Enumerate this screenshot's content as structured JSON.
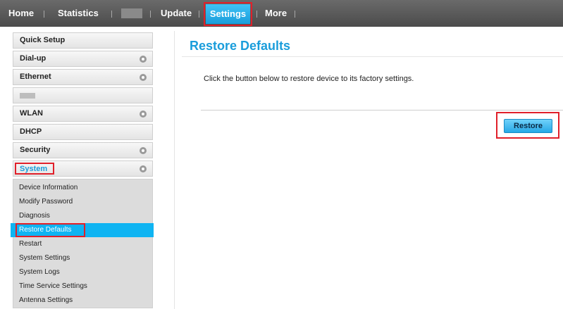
{
  "topnav": {
    "home": "Home",
    "statistics": "Statistics",
    "update": "Update",
    "settings": "Settings",
    "more": "More"
  },
  "sidebar": {
    "items": [
      {
        "label": "Quick Setup"
      },
      {
        "label": "Dial-up"
      },
      {
        "label": "Ethernet"
      },
      {
        "label": ""
      },
      {
        "label": "WLAN"
      },
      {
        "label": "DHCP"
      },
      {
        "label": "Security"
      },
      {
        "label": "System"
      }
    ],
    "system_submenu": [
      "Device Information",
      "Modify Password",
      "Diagnosis",
      "Restore Defaults",
      "Restart",
      "System Settings",
      "System Logs",
      "Time Service Settings",
      "Antenna Settings"
    ]
  },
  "main": {
    "title": "Restore Defaults",
    "description": "Click the button below to restore device to its factory settings.",
    "restore_label": "Restore"
  },
  "colors": {
    "accent": "#1a9ddb",
    "active_menu": "#0fb4f2",
    "highlight_border": "#e0202a",
    "topnav_bg": "#555555"
  }
}
